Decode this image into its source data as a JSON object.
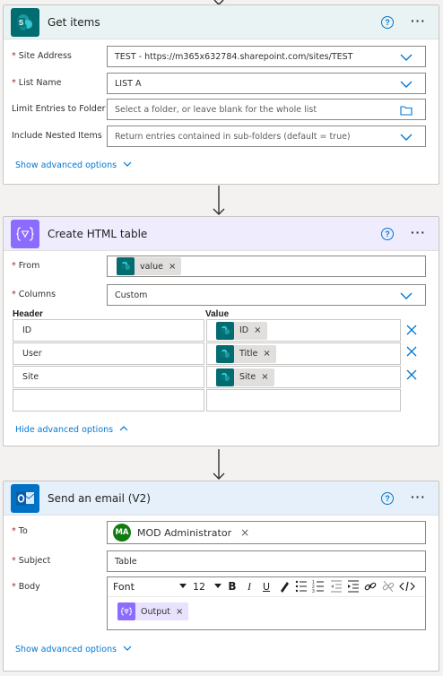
{
  "get_items": {
    "title": "Get items",
    "help": "?",
    "more": "···",
    "fields": [
      {
        "label": "Site Address",
        "required": true,
        "value": "TEST - https://m365x632784.sharepoint.com/sites/TEST"
      },
      {
        "label": "List Name",
        "required": true,
        "value": "LIST A"
      },
      {
        "label": "Limit Entries to Folder",
        "required": false,
        "placeholder": "Select a folder, or leave blank for the whole list"
      },
      {
        "label": "Include Nested Items",
        "required": false,
        "placeholder": "Return entries contained in sub-folders (default = true)"
      }
    ],
    "show_advanced": "Show advanced options"
  },
  "create_table": {
    "title": "Create HTML table",
    "help": "?",
    "more": "···",
    "from_label": "From",
    "from_token": "value",
    "columns_label": "Columns",
    "columns_value": "Custom",
    "header_col": "Header",
    "value_col": "Value",
    "rows": [
      {
        "header": "ID",
        "value": "ID"
      },
      {
        "header": "User",
        "value": "Title"
      },
      {
        "header": "Site",
        "value": "Site"
      }
    ],
    "hide_advanced": "Hide advanced options"
  },
  "send_email": {
    "title": "Send an email (V2)",
    "help": "?",
    "more": "···",
    "to_label": "To",
    "to_initials": "MA",
    "to_name": "MOD Administrator",
    "subject_label": "Subject",
    "subject_value": "Table",
    "body_label": "Body",
    "font_value": "Font",
    "font_size": "12",
    "body_token": "Output",
    "show_advanced": "Show advanced options"
  },
  "colors": {
    "sharepoint": "#036c70",
    "data_op": "#8c6cff",
    "outlook": "#0072c6",
    "link": "#0078d4"
  }
}
